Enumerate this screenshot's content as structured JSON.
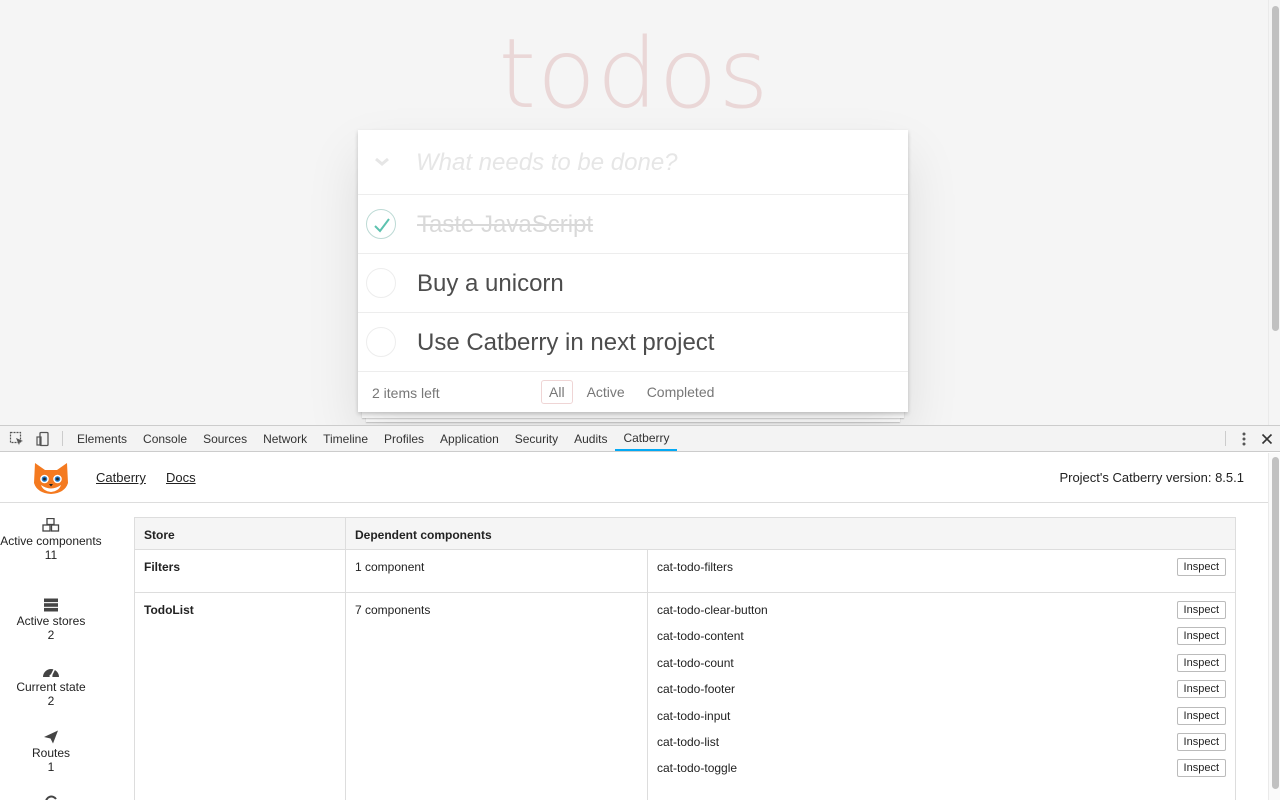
{
  "app": {
    "title": "todos",
    "new_todo_placeholder": "What needs to be done?",
    "todos": [
      {
        "label": "Taste JavaScript",
        "completed": true
      },
      {
        "label": "Buy a unicorn",
        "completed": false
      },
      {
        "label": "Use Catberry in next project",
        "completed": false
      }
    ],
    "items_left": "2 items left",
    "filters": {
      "all": "All",
      "active": "Active",
      "completed": "Completed"
    }
  },
  "devtools": {
    "tabs": [
      "Elements",
      "Console",
      "Sources",
      "Network",
      "Timeline",
      "Profiles",
      "Application",
      "Security",
      "Audits",
      "Catberry"
    ],
    "active_tab": "Catberry"
  },
  "catberry": {
    "links": {
      "catberry": "Catberry",
      "docs": "Docs"
    },
    "version_text": "Project's Catberry version: 8.5.1",
    "sidebar": [
      {
        "label": "Active components",
        "count": "11",
        "icon": "cubes-icon"
      },
      {
        "label": "Active stores",
        "count": "2",
        "icon": "server-icon"
      },
      {
        "label": "Current state",
        "count": "2",
        "icon": "dashboard-icon"
      },
      {
        "label": "Routes",
        "count": "1",
        "icon": "paper-plane-icon"
      }
    ],
    "table": {
      "headers": {
        "store": "Store",
        "dependent": "Dependent components"
      },
      "inspect_label": "Inspect",
      "rows": [
        {
          "store": "Filters",
          "count": "1 component",
          "components": [
            "cat-todo-filters"
          ]
        },
        {
          "store": "TodoList",
          "count": "7 components",
          "components": [
            "cat-todo-clear-button",
            "cat-todo-content",
            "cat-todo-count",
            "cat-todo-footer",
            "cat-todo-input",
            "cat-todo-list",
            "cat-todo-toggle"
          ]
        }
      ]
    }
  },
  "colors": {
    "accent": "#03a9f4",
    "title": "#af2f2f",
    "check": "#5dc2af"
  }
}
